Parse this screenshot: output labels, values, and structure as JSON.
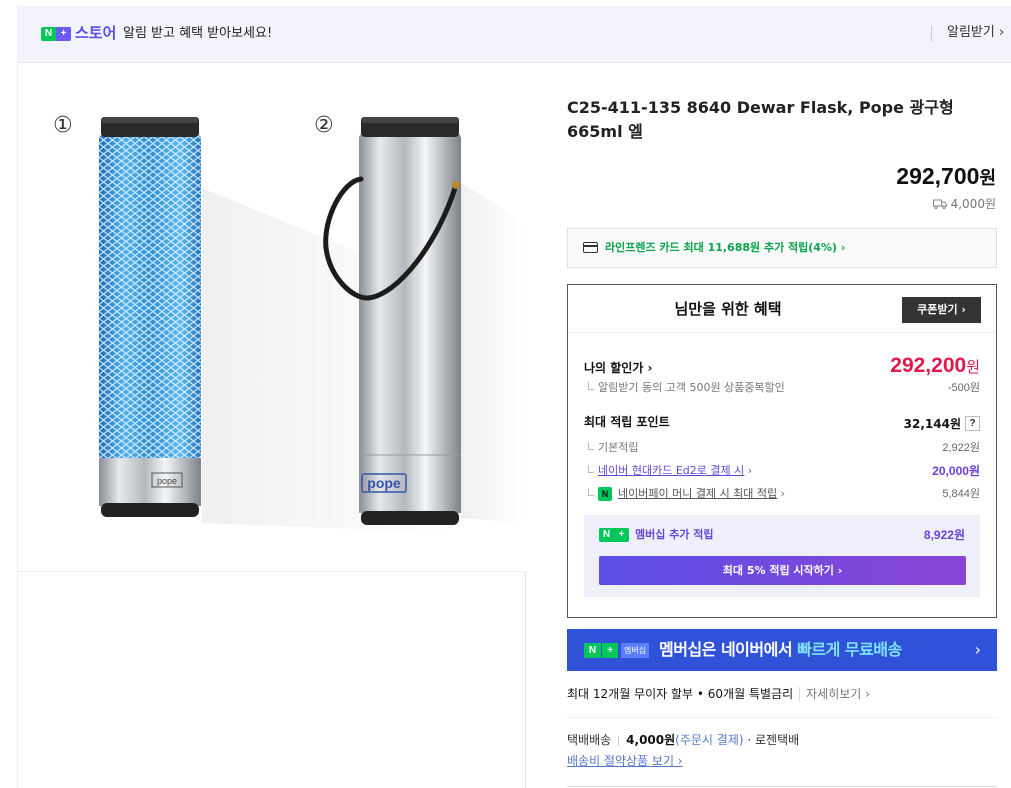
{
  "banner": {
    "badge_n": "N",
    "badge_plus": "+",
    "store": "스토어",
    "message": "알림 받고 혜택 받아보세요!",
    "alarm_label": "알림받기 ›"
  },
  "gallery": {
    "label_1": "①",
    "label_2": "②",
    "brand_text": "pope"
  },
  "product": {
    "title": "C25-411-135 8640 Dewar Flask, Pope 광구형 665ml 엘",
    "price": "292,700",
    "price_unit": "원",
    "shipping_fee": "4,000원"
  },
  "card_promo": {
    "text": "라인프렌즈 카드 최대 11,688원 추가 적립(4%) ›"
  },
  "benefit": {
    "title": "님만을 위한 혜택",
    "coupon_button": "쿠폰받기 ›",
    "my_price_label": "나의 할인가 ›",
    "my_price": "292,200",
    "my_price_unit": "원",
    "alarm_discount_label": "알림받기 동의 고객 500원 상품중복할인",
    "alarm_discount_value": "-500원",
    "max_point_label": "최대 적립 포인트",
    "max_point_value": "32,144원",
    "qmark": "?",
    "basic_label": "기본적립",
    "basic_value": "2,922원",
    "card_label": "네이버 현대카드 Ed2로 결제 시",
    "card_arrow": "›",
    "card_value": "20,000원",
    "npay_icon": "N",
    "npay_label": "네이버페이 머니 결제 시 최대 적립",
    "npay_arrow": "›",
    "npay_value": "5,844원",
    "membership_label": "멤버십 추가 적립",
    "membership_value": "8,922원",
    "start_button": "최대 5% 적립 시작하기 ›"
  },
  "member_bar": {
    "badge_n": "N",
    "badge_plus": "+",
    "tag": "멤버십",
    "text_main": "멤버십은 네이버에서 ",
    "text_highlight": "빠르게 무료배송",
    "arrow": "›"
  },
  "installment": {
    "text": "최대 12개월 무이자 할부 • 60개월 특별금리",
    "more": "자세히보기 ›"
  },
  "delivery": {
    "type": "택배배송",
    "fee": "4,000원",
    "fee_note": "(주문시 결제)",
    "courier": "· 로젠택배",
    "saving_link": "배송비 절약상품 보기 ›"
  },
  "colors": {
    "naver_green": "#03c75a",
    "brand_purple": "#5a4af4",
    "discount_red": "#e0194c",
    "member_blue": "#2f52d8",
    "flask_blue": "#2f8fd6"
  },
  "icons": {
    "card": "credit-card-icon",
    "truck": "truck-icon",
    "chevron": "chevron-right-icon"
  }
}
